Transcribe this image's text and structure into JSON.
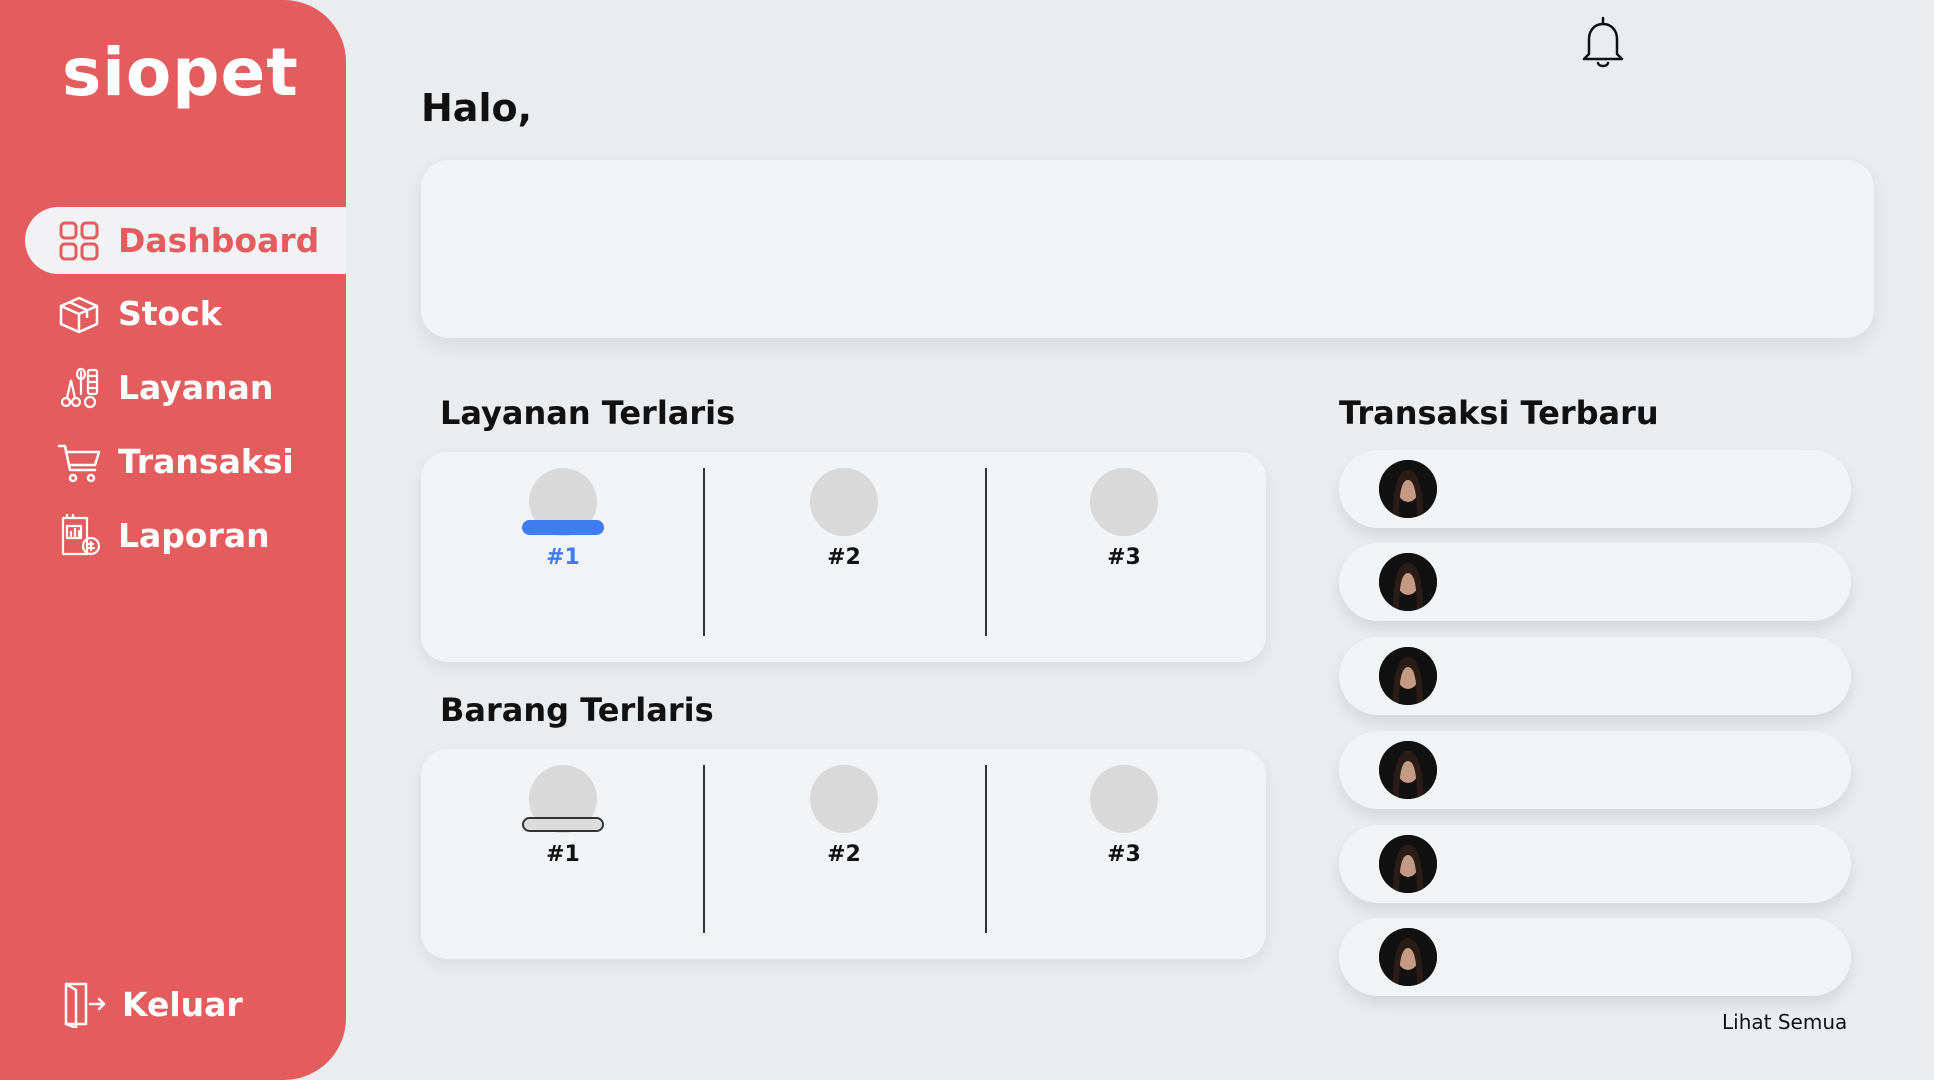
{
  "app": {
    "logo": "siopet"
  },
  "sidebar": {
    "items": [
      {
        "label": "Dashboard",
        "icon": "grid-icon",
        "active": true
      },
      {
        "label": "Stock",
        "icon": "box-icon"
      },
      {
        "label": "Layanan",
        "icon": "grooming-tools-icon"
      },
      {
        "label": "Transaksi",
        "icon": "cart-icon"
      },
      {
        "label": "Laporan",
        "icon": "report-icon"
      }
    ],
    "logout_label": "Keluar"
  },
  "header": {
    "greeting": "Halo,"
  },
  "sections": {
    "services": {
      "title": "Layanan Terlaris",
      "ranks": [
        "#1",
        "#2",
        "#3"
      ]
    },
    "products": {
      "title": "Barang Terlaris",
      "ranks": [
        "#1",
        "#2",
        "#3"
      ]
    },
    "transactions": {
      "title": "Transaksi Terbaru",
      "see_all": "Lihat Semua"
    }
  },
  "colors": {
    "brand": "#e35d5e",
    "accent": "#3f7cf0",
    "background": "#ebecee"
  }
}
